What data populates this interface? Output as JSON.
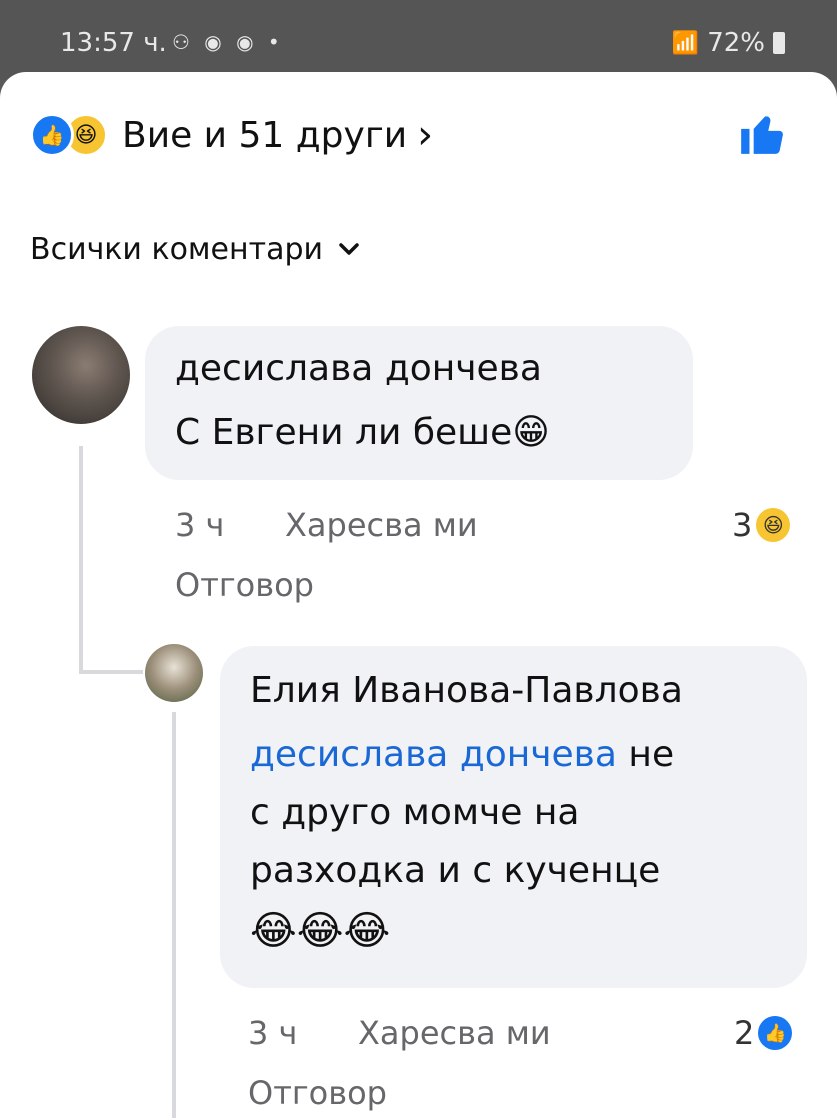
{
  "status_bar": {
    "time": "13:57 ч.",
    "icons_left": "⚇ ◉ ◉ •",
    "battery": "72%"
  },
  "reactions": {
    "summary": "Вие и 51 други",
    "icons": [
      "like-icon",
      "haha-icon"
    ]
  },
  "filter": {
    "label": "Всички коментари"
  },
  "comments": [
    {
      "author": "десислава дончева",
      "text": "С Евгени ли беше",
      "emoji": "😁",
      "time": "3 ч",
      "like_label": "Харесва ми",
      "reply_label": "Отговор",
      "reaction_count": "3",
      "reaction_icon": "haha-icon"
    },
    {
      "author": "Елия Иванова-Павлова",
      "mention": "десислава дончева",
      "text_lines": [
        "не",
        "с друго момче на",
        "разходка  и с кученце"
      ],
      "emoji": "😂😂😂",
      "time": "3 ч",
      "like_label": "Харесва ми",
      "reply_label": "Отговор",
      "reaction_count": "2",
      "reaction_icon": "like-icon"
    }
  ]
}
